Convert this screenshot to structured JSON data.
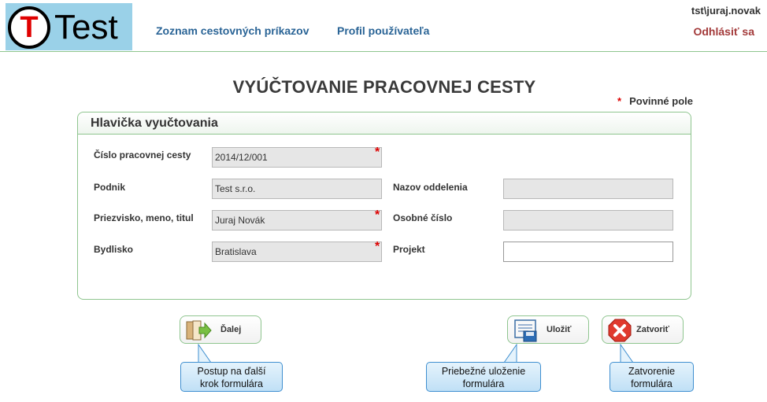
{
  "header": {
    "logo_letter": "T",
    "logo_word": "Test",
    "nav": [
      {
        "label": "Zoznam cestovných príkazov"
      },
      {
        "label": "Profil používateľa"
      }
    ],
    "user": "tst\\juraj.novak",
    "logout": "Odhlásiť sa"
  },
  "page": {
    "title": "VYÚČTOVANIE PRACOVNEJ CESTY",
    "required_star": "*",
    "required_note": "Povinné pole"
  },
  "panel": {
    "title": "Hlavička vyučtovania",
    "fields": {
      "trip_number": {
        "label": "Číslo pracovnej cesty",
        "value": "2014/12/001"
      },
      "company": {
        "label": "Podnik",
        "value": "Test s.r.o."
      },
      "name": {
        "label": "Priezvisko, meno, titul",
        "value": "Juraj Novák"
      },
      "residence": {
        "label": "Bydlisko",
        "value": "Bratislava"
      },
      "department": {
        "label": "Nazov oddelenia",
        "value": ""
      },
      "personal_number": {
        "label": "Osobné číslo",
        "value": ""
      },
      "project": {
        "label": "Projekt",
        "value": ""
      }
    }
  },
  "buttons": {
    "next": "Ďalej",
    "save": "Uložiť",
    "close": "Zatvoriť"
  },
  "tooltips": {
    "next_line1": "Postup na ďalší",
    "next_line2": "krok formulára",
    "save_line1": "Priebežné uloženie",
    "save_line2": "formulára",
    "close_line1": "Zatvorenie",
    "close_line2": "formulára"
  },
  "colors": {
    "accent_green": "#8fc58f",
    "nav_blue": "#2a6496",
    "logout_red": "#a33a3a",
    "required_red": "#dd0000"
  }
}
